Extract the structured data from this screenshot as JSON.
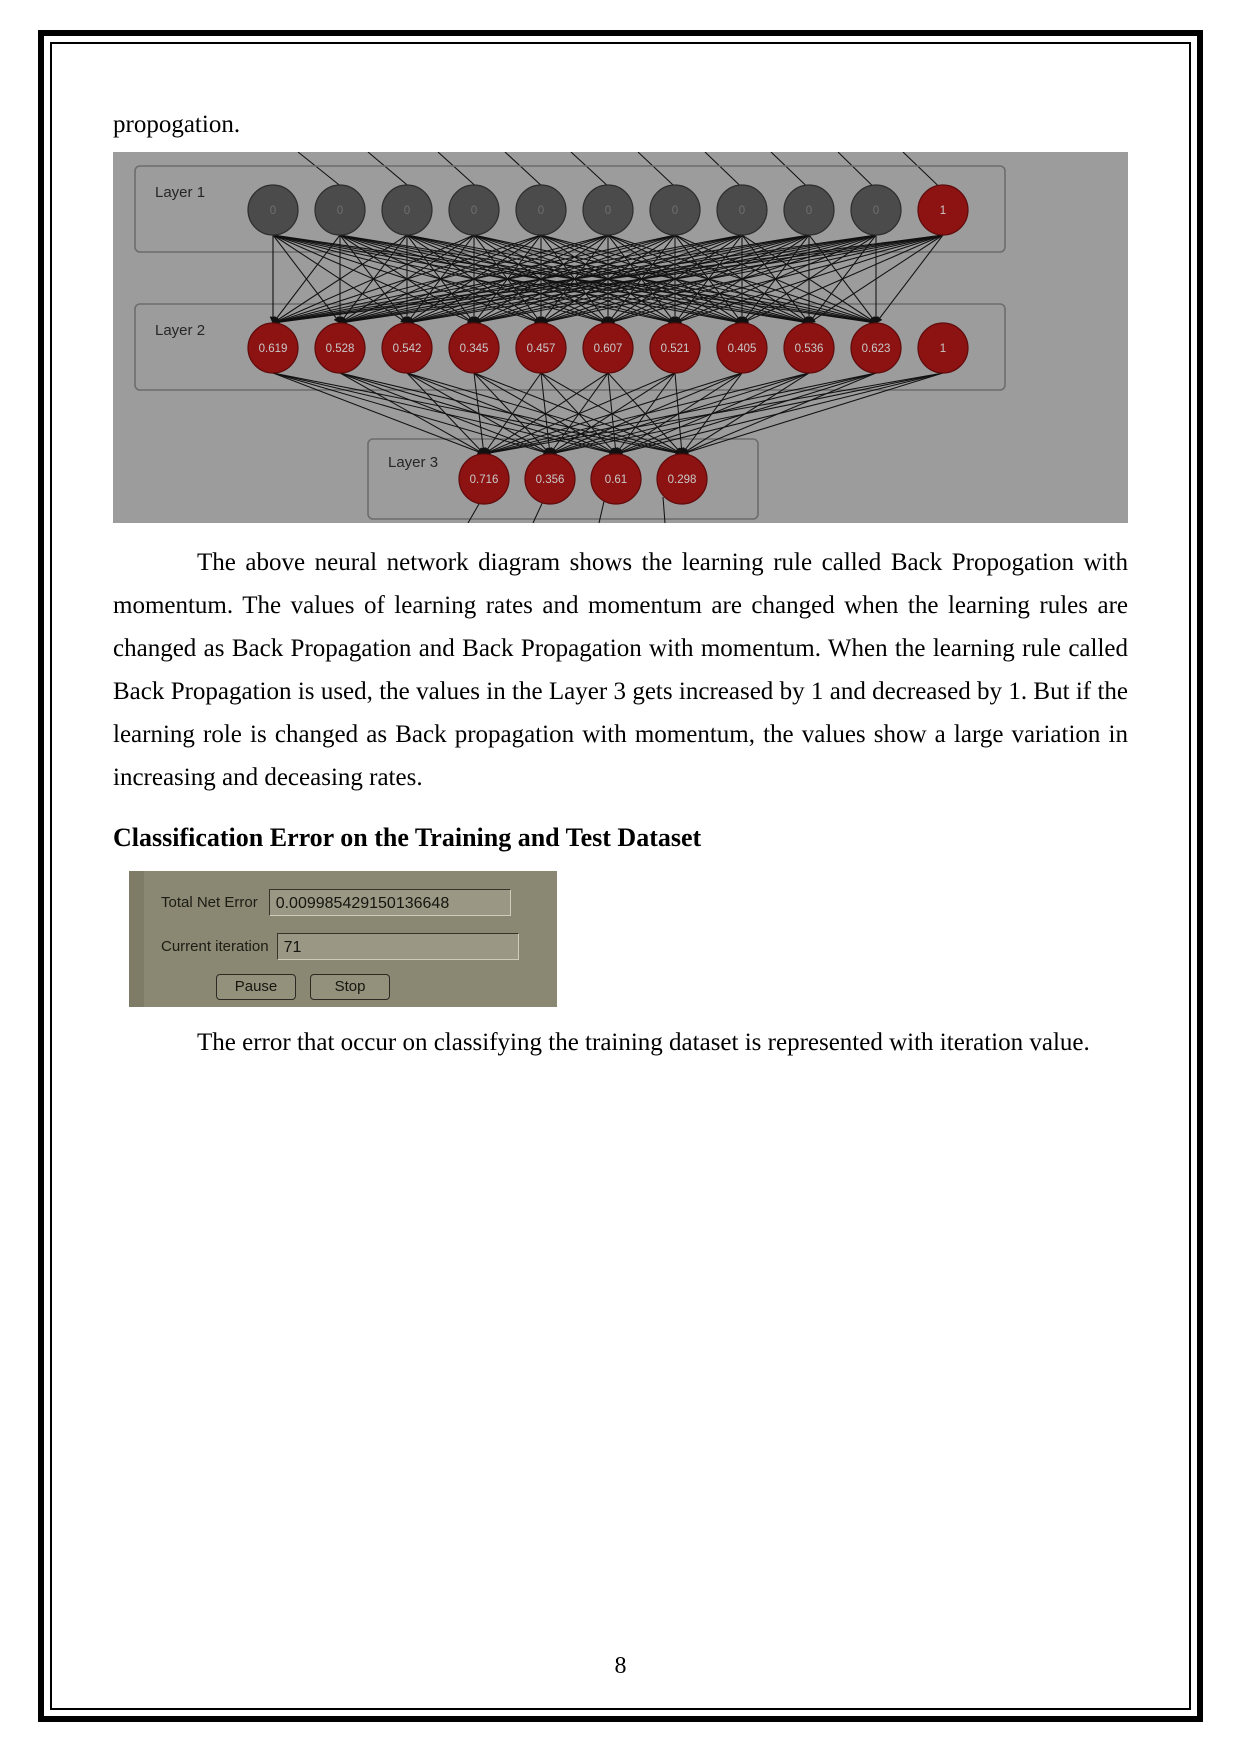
{
  "document": {
    "lead_line": "propogation.",
    "page_number": "8",
    "paragraph_1": "The above neural network diagram shows the learning rule called Back Propogation with momentum. The values of learning rates and momentum are changed when the learning rules are changed as Back Propagation and Back Propagation with momentum. When the learning rule called Back Propagation is used, the values in the Layer 3 gets increased by 1 and decreased by 1. But if the learning role is changed as Back propagation with momentum, the values show a large variation in increasing and deceasing rates.",
    "section_heading": "Classification Error on the Training and Test Dataset",
    "caption_text": "The error that occur on classifying the training dataset is represented with iteration value."
  },
  "neural_network": {
    "background_color": "#9c9c9c",
    "node_red_color": "#8d1212",
    "node_gray_color": "#4b4b4b",
    "layers": [
      {
        "label": "Layer 1",
        "nodes": [
          {
            "value": "0",
            "type": "gray"
          },
          {
            "value": "0",
            "type": "gray"
          },
          {
            "value": "0",
            "type": "gray"
          },
          {
            "value": "0",
            "type": "gray"
          },
          {
            "value": "0",
            "type": "gray"
          },
          {
            "value": "0",
            "type": "gray"
          },
          {
            "value": "0",
            "type": "gray"
          },
          {
            "value": "0",
            "type": "gray"
          },
          {
            "value": "0",
            "type": "gray"
          },
          {
            "value": "0",
            "type": "gray"
          },
          {
            "value": "1",
            "type": "red"
          }
        ]
      },
      {
        "label": "Layer 2",
        "nodes": [
          {
            "value": "0.619",
            "type": "red"
          },
          {
            "value": "0.528",
            "type": "red"
          },
          {
            "value": "0.542",
            "type": "red"
          },
          {
            "value": "0.345",
            "type": "red"
          },
          {
            "value": "0.457",
            "type": "red"
          },
          {
            "value": "0.607",
            "type": "red"
          },
          {
            "value": "0.521",
            "type": "red"
          },
          {
            "value": "0.405",
            "type": "red"
          },
          {
            "value": "0.536",
            "type": "red"
          },
          {
            "value": "0.623",
            "type": "red"
          },
          {
            "value": "1",
            "type": "red"
          }
        ]
      },
      {
        "label": "Layer 3",
        "nodes": [
          {
            "value": "0.716",
            "type": "red"
          },
          {
            "value": "0.356",
            "type": "red"
          },
          {
            "value": "0.61",
            "type": "red"
          },
          {
            "value": "0.298",
            "type": "red"
          }
        ]
      }
    ]
  },
  "training_panel": {
    "background_color": "#8a8772",
    "total_net_error_label": "Total Net Error",
    "total_net_error_value": "0.009985429150136648",
    "current_iteration_label": "Current iteration",
    "current_iteration_value": "71",
    "pause_button": "Pause",
    "stop_button": "Stop"
  }
}
